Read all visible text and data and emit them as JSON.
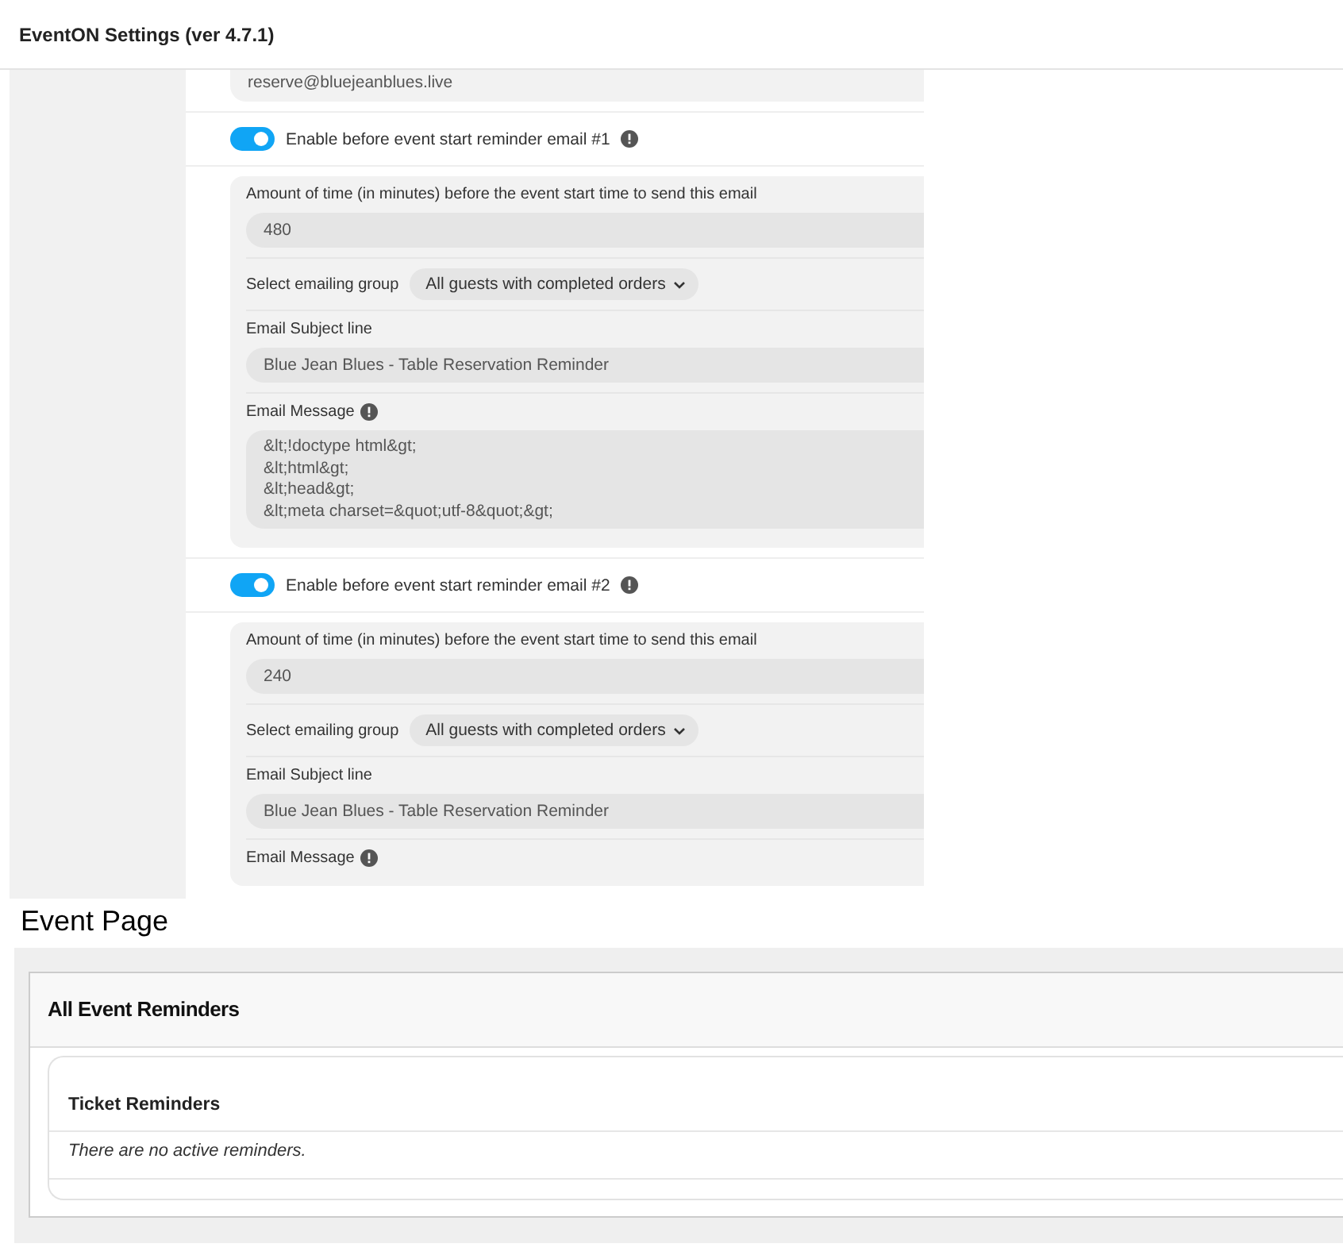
{
  "settings": {
    "title": "EventON Settings (ver 4.7.1)",
    "email_value": "reserve@bluejeanblues.live",
    "reminders": [
      {
        "label": "Enable before event start reminder email #1",
        "on": true,
        "time_label": "Amount of time (in minutes) before the event start time to send this email",
        "time_value": "480",
        "group_label": "Select emailing group",
        "group_value": "All guests with completed orders",
        "subject_label": "Email Subject line",
        "subject_value": "Blue Jean Blues - Table Reservation Reminder",
        "message_label": "Email Message",
        "message_lines": [
          "&lt;!doctype html&gt;",
          "&lt;html&gt;",
          "&lt;head&gt;",
          "&lt;meta charset=&quot;utf-8&quot;&gt;"
        ]
      },
      {
        "label": "Enable before event start reminder email #2",
        "on": true,
        "time_label": "Amount of time (in minutes) before the event start time to send this email",
        "time_value": "240",
        "group_label": "Select emailing group",
        "group_value": "All guests with completed orders",
        "subject_label": "Email Subject line",
        "subject_value": "Blue Jean Blues - Table Reservation Reminder",
        "message_label": "Email Message"
      }
    ]
  },
  "event_page": {
    "heading": "Event Page",
    "card_title": "All Event Reminders",
    "section_title": "Ticket Reminders",
    "empty_text": "There are no active reminders."
  }
}
